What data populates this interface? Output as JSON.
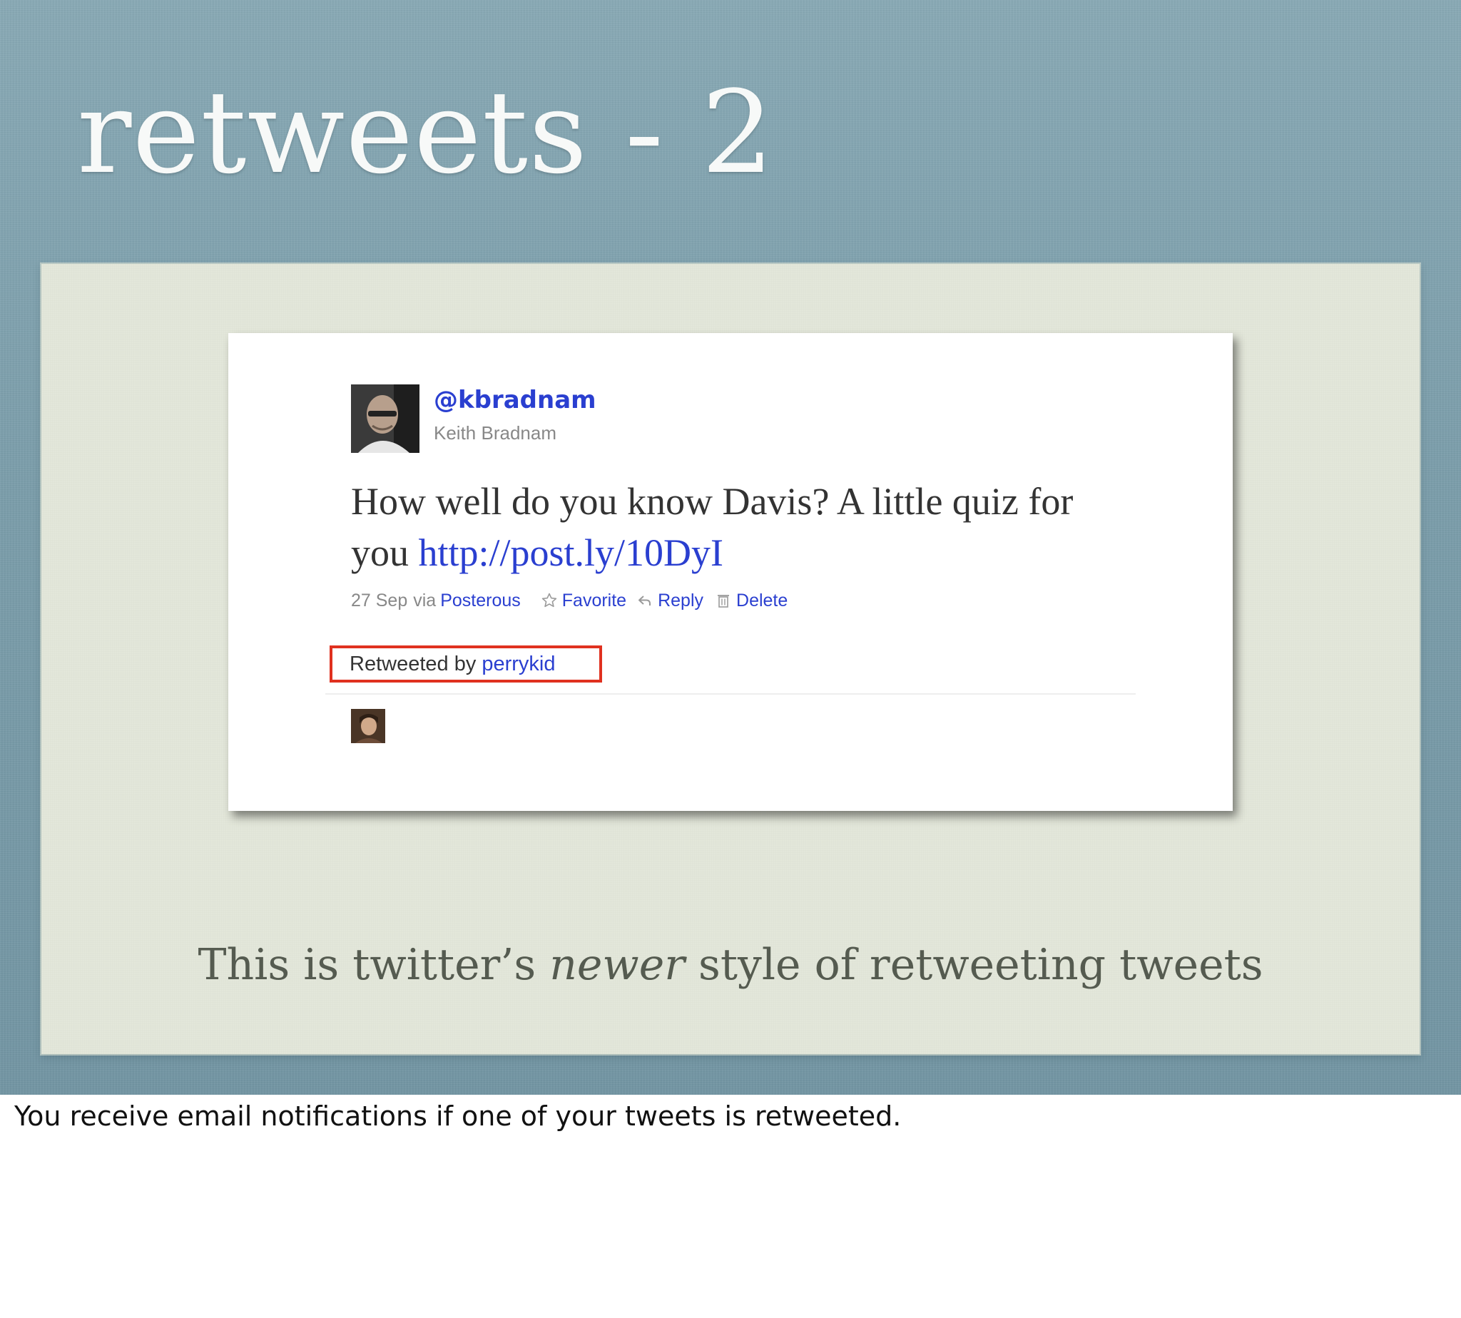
{
  "slide": {
    "title": "retweets - 2",
    "caption": {
      "before": "This is twitter’s ",
      "emphasis": "newer",
      "after": " style of retweeting tweets"
    }
  },
  "tweet": {
    "username": "@kbradnam",
    "fullname": "Keith Bradnam",
    "text": "How well do you know Davis? A little quiz for you ",
    "link": "http://post.ly/10DyI",
    "date": "27 Sep",
    "via_label": "via",
    "source": "Posterous",
    "actions": {
      "favorite": "Favorite",
      "reply": "Reply",
      "delete": "Delete"
    },
    "retweet": {
      "label": "Retweeted by",
      "user": "perrykid"
    },
    "icons": {
      "favorite": "star-outline-icon",
      "reply": "reply-arrow-icon",
      "delete": "trash-icon"
    }
  },
  "notes": "You receive email notifications if one of your tweets is retweeted.",
  "colors": {
    "link": "#2a3fd0",
    "highlight_box": "#e0311f",
    "slide_background": "#7d9fac",
    "canvas": "#e3e7da"
  }
}
